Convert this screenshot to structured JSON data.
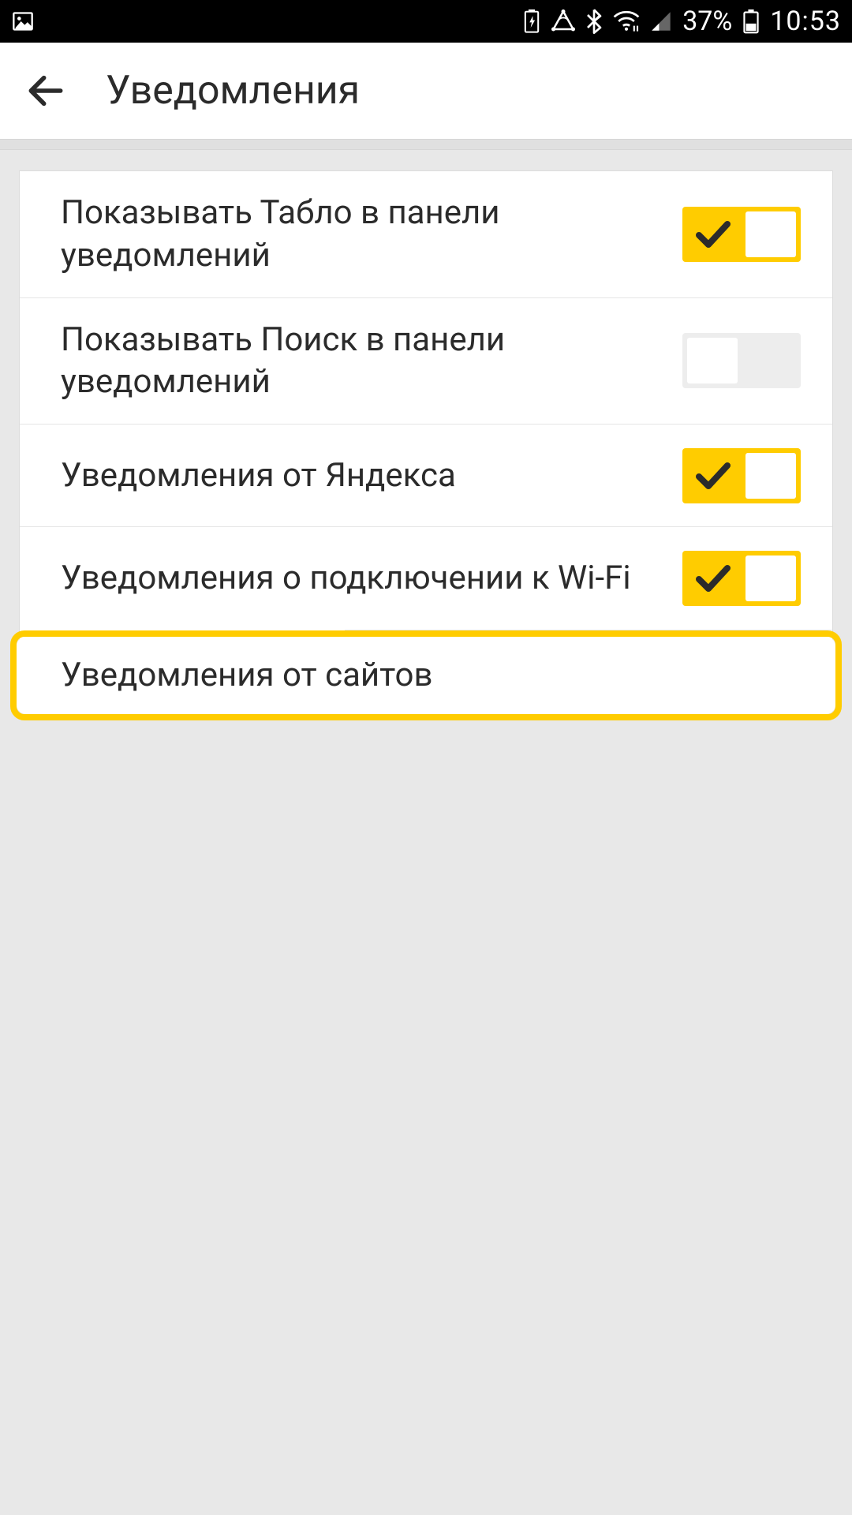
{
  "status": {
    "battery_pct": "37%",
    "time": "10:53"
  },
  "header": {
    "title": "Уведомления"
  },
  "settings": {
    "items": [
      {
        "label": "Показывать Табло в панели уведомлений",
        "on": true
      },
      {
        "label": "Показывать Поиск в панели уведомлений",
        "on": false
      },
      {
        "label": "Уведомления от Яндекса",
        "on": true
      },
      {
        "label": "Уведомления о подключении к Wi-Fi",
        "on": true
      }
    ],
    "site_notifications_label": "Уведомления от сайтов"
  },
  "colors": {
    "accent": "#ffcc00",
    "text": "#2b2b2b",
    "bg": "#e8e8e8"
  }
}
